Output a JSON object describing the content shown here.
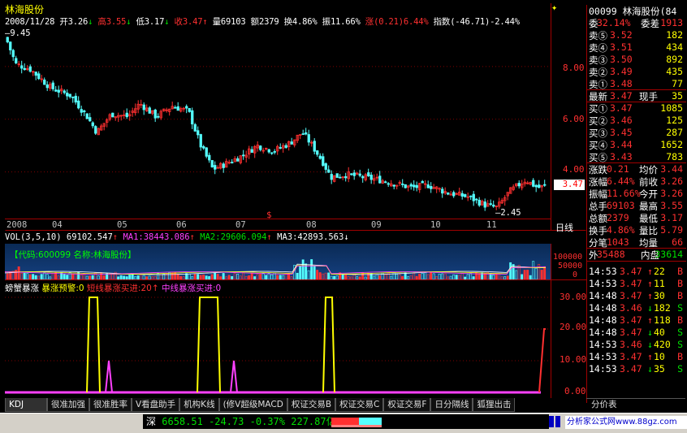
{
  "stock": {
    "name": "林海股份",
    "code": "00099",
    "code_name": "林海股份",
    "code_suffix": "(84"
  },
  "quote_line": {
    "date": "2008/11/28",
    "open_label": "开",
    "open": "3.26",
    "high_label": "高",
    "high": "3.55",
    "low_label": "低",
    "low": "3.17",
    "close_label": "收",
    "close": "3.47",
    "vol_label": "量",
    "vol": "69103",
    "amt_label": "额",
    "amt": "2379",
    "turn_label": "换",
    "turn": "4.86%",
    "amp_label": "振",
    "amp": "11.66%",
    "chg_label": "涨",
    "chg": "(0.21)6.44%",
    "idx_label": "指数",
    "idx": "(-46.71)-2.44%"
  },
  "main_chart": {
    "max_label": "9.45",
    "min_label": "2.45",
    "y_ticks": [
      "8.00",
      "6.00",
      "4.00"
    ],
    "price_tag": "3.47",
    "dates": [
      "2008",
      "04",
      "05",
      "06",
      "07",
      "08",
      "09",
      "10",
      "11"
    ],
    "period_label": "日线",
    "marker": "$",
    "colors": {
      "up": "#ff3030",
      "down": "#54ffff"
    }
  },
  "volume": {
    "legend_vol": "VOL(3,5,10)",
    "vol_val": "69102.547",
    "ma1": "MA1:38443.086",
    "ma2": "MA2:29606.094",
    "ma3": "MA3:42893.563",
    "banner": "【代码:600099  名称:林海股份】",
    "y_ticks": [
      "100000",
      "50000",
      "0"
    ]
  },
  "indicator": {
    "name": "螃蟹暴涨",
    "l1": "暴涨预警:",
    "v1": "0",
    "l2": "短线暴涨买进:",
    "v2": "20",
    "l3": "中线暴涨买进:",
    "v3": "0",
    "y_ticks": [
      "30.00",
      "20.00",
      "10.00",
      "0.00"
    ]
  },
  "order_book": {
    "ratio_label": "委",
    "ratio": "32.14%",
    "diff_label": "委差",
    "diff": "1913",
    "asks": [
      {
        "label": "卖⑤",
        "price": "3.52",
        "vol": "182"
      },
      {
        "label": "卖④",
        "price": "3.51",
        "vol": "434"
      },
      {
        "label": "卖③",
        "price": "3.50",
        "vol": "892"
      },
      {
        "label": "卖②",
        "price": "3.49",
        "vol": "435"
      },
      {
        "label": "卖①",
        "price": "3.48",
        "vol": "77"
      }
    ],
    "last_label": "最新",
    "last": "3.47",
    "cur_vol_label": "现手",
    "cur_vol": "35",
    "bids": [
      {
        "label": "买①",
        "price": "3.47",
        "vol": "1085"
      },
      {
        "label": "买②",
        "price": "3.46",
        "vol": "125"
      },
      {
        "label": "买③",
        "price": "3.45",
        "vol": "287"
      },
      {
        "label": "买④",
        "price": "3.44",
        "vol": "1652"
      },
      {
        "label": "买⑤",
        "price": "3.43",
        "vol": "783"
      }
    ],
    "stats": [
      {
        "l1": "涨跌",
        "v1": "0.21",
        "l2": "均价",
        "v2": "3.44"
      },
      {
        "l1": "涨幅",
        "v1": "6.44%",
        "l2": "前收",
        "v2": "3.26"
      },
      {
        "l1": "振幅",
        "v1": "11.66%",
        "l2": "今开",
        "v2": "3.26"
      },
      {
        "l1": "总手",
        "v1": "69103",
        "l2": "最高",
        "v2": "3.55"
      },
      {
        "l1": "总额",
        "v1": "2379",
        "l2": "最低",
        "v2": "3.17"
      },
      {
        "l1": "换手",
        "v1": "4.86%",
        "l2": "量比",
        "v2": "5.79"
      },
      {
        "l1": "分笔",
        "v1": "1043",
        "l2": "均量",
        "v2": "66"
      }
    ],
    "outer_label": "外",
    "outer": "35488",
    "inner_label": "内盘",
    "inner": "33614"
  },
  "ticks": [
    {
      "time": "14:53",
      "price": "3.47",
      "vol": "22",
      "side": "B"
    },
    {
      "time": "14:53",
      "price": "3.47",
      "vol": "11",
      "side": "B"
    },
    {
      "time": "14:48",
      "price": "3.47",
      "vol": "30",
      "side": "B"
    },
    {
      "time": "14:48",
      "price": "3.46",
      "vol": "182",
      "side": "S"
    },
    {
      "time": "14:48",
      "price": "3.47",
      "vol": "118",
      "side": "B"
    },
    {
      "time": "14:48",
      "price": "3.47",
      "vol": "40",
      "side": "S"
    },
    {
      "time": "14:53",
      "price": "3.46",
      "vol": "420",
      "side": "S"
    },
    {
      "time": "14:53",
      "price": "3.47",
      "vol": "10",
      "side": "B"
    },
    {
      "time": "14:53",
      "price": "3.47",
      "vol": "35",
      "side": "S"
    }
  ],
  "tabs": [
    "KDJ",
    "很准加强",
    "很准胜率",
    "V看盘助手",
    "机构K线",
    "(修V超级MACD",
    "权证交易B",
    "权证交易C",
    "权证交易F",
    "日分隔线",
    "狐狸出击"
  ],
  "right_tab": "分价表",
  "status": {
    "market": "深",
    "index": "6658.51",
    "change": "-24.73",
    "pct": "-0.37%",
    "amount": "227.87亿",
    "site": "分析家公式网www.88gz.com"
  }
}
